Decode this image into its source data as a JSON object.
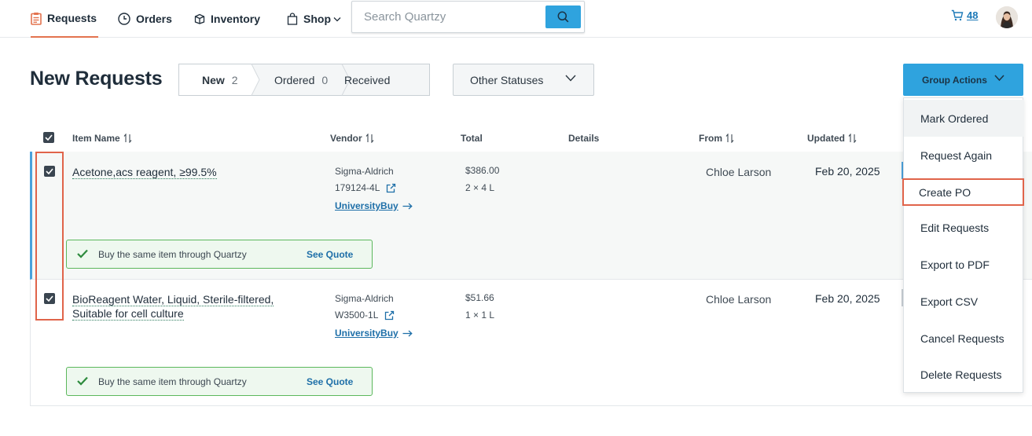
{
  "nav": {
    "items": [
      {
        "label": "Requests",
        "icon": "clipboard-icon",
        "active": true
      },
      {
        "label": "Orders",
        "icon": "clock-icon"
      },
      {
        "label": "Inventory",
        "icon": "box-icon"
      },
      {
        "label": "Shop",
        "icon": "shopping-bag-icon"
      }
    ],
    "search": {
      "placeholder": "Search Quartzy",
      "value": ""
    },
    "cart": {
      "count": "48",
      "icon": "cart-icon"
    },
    "avatar": {
      "icon": "user-avatar"
    }
  },
  "page": {
    "title": "New Requests",
    "status_tabs": [
      {
        "label": "New",
        "count": "2"
      },
      {
        "label": "Ordered",
        "count": "0"
      },
      {
        "label": "Received",
        "count": ""
      }
    ],
    "other_statuses": "Other Statuses",
    "group_actions": "Group Actions"
  },
  "table": {
    "headers": {
      "item_name": "Item Name",
      "vendor": "Vendor",
      "total": "Total",
      "details": "Details",
      "from": "From",
      "updated": "Updated"
    },
    "rows": [
      {
        "item_name": "Acetone,acs reagent, ≥99.5%",
        "item_name_line2": "",
        "vendor": "Sigma-Aldrich",
        "sku": "179124-4L",
        "link": "UniversityBuy",
        "total": "$386.00",
        "quantity": "2 × 4 L",
        "from": "Chloe Larson",
        "updated": "Feb 20, 2025",
        "banner": "Buy the same item through Quartzy",
        "banner_link": "See Quote",
        "checked": true
      },
      {
        "item_name": "BioReagent Water, Liquid, Sterile-filtered,",
        "item_name_line2": "Suitable for cell culture",
        "vendor": "Sigma-Aldrich",
        "sku": "W3500-1L",
        "link": "UniversityBuy",
        "total": "$51.66",
        "quantity": "1 × 1 L",
        "from": "Chloe Larson",
        "updated": "Feb 20, 2025",
        "banner": "Buy the same item through Quartzy",
        "banner_link": "See Quote",
        "checked": true
      }
    ]
  },
  "group_actions_menu": [
    {
      "label": "Mark Ordered",
      "state": "hover"
    },
    {
      "label": "Request Again"
    },
    {
      "label": "Create PO",
      "state": "selected"
    },
    {
      "label": "Edit Requests"
    },
    {
      "label": "Export to PDF"
    },
    {
      "label": "Export CSV"
    },
    {
      "label": "Cancel Requests"
    },
    {
      "label": "Delete Requests"
    }
  ],
  "colors": {
    "accent_blue": "#2fa3de",
    "active_tab_orange": "#e3734f",
    "highlight_red": "#e0644a",
    "banner_green": "#5cb85c"
  }
}
